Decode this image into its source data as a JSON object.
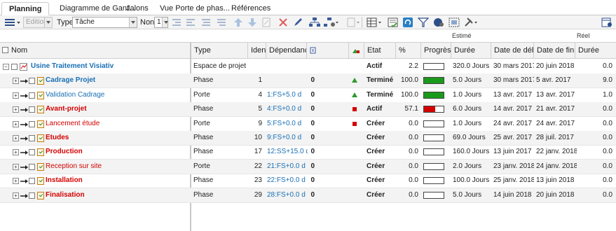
{
  "tabs": [
    {
      "label": "Planning",
      "active": true
    },
    {
      "label": "Diagramme de Gant..."
    },
    {
      "label": "Jalons"
    },
    {
      "label": "Vue Porte de phas..."
    },
    {
      "label": "Références"
    }
  ],
  "toolbar": {
    "edition_label": "Edition",
    "type_label": "Type",
    "type_value": "Tâche",
    "non_label": "Non",
    "level_value": "1"
  },
  "groups": {
    "estime": "Estimé",
    "reel": "Réel"
  },
  "columns": {
    "nom": "Nom",
    "type": "Type",
    "ident": "Identi",
    "dependance": "Dépendance",
    "etat": "Etat",
    "pct": "%",
    "progres": "Progrès",
    "duree": "Durée",
    "debut": "Date de début",
    "fin": "Date de fin",
    "duree_reel": "Durée"
  },
  "colors": {
    "red": "#d40000",
    "blue": "#1a6fb5",
    "green": "#1a9a1a",
    "accent": "#1a6fb5"
  },
  "rows": [
    {
      "nom": "Usine Traitement Visiativ",
      "type": "Espace de projet",
      "ident": "",
      "dep": "",
      "count": "",
      "etat": "Actif",
      "pct": "2.2",
      "progress": 0.0,
      "duree": "320.0 Jours",
      "debut": "30 mars 2017",
      "fin": "20 juin 2018",
      "reel": "0.0",
      "indicator": ""
    },
    {
      "nom": "Cadrage Projet",
      "type": "Phase",
      "ident": "1",
      "dep": "",
      "count": "0",
      "etat": "Terminé",
      "pct": "100.0",
      "progress": 1.0,
      "duree": "5.0 Jours",
      "debut": "30 mars 2017",
      "fin": "5 avr. 2017",
      "reel": "9.0",
      "indicator": "up"
    },
    {
      "nom": "Validation Cadrage",
      "type": "Porte",
      "ident": "4",
      "dep": "1:FS+5.0 d",
      "count": "0",
      "etat": "Terminé",
      "pct": "100.0",
      "progress": 1.0,
      "duree": "1.0 Jours",
      "debut": "13 avr. 2017",
      "fin": "13 avr. 2017",
      "reel": "1.0",
      "indicator": "up"
    },
    {
      "nom": "Avant-projet",
      "type": "Phase",
      "ident": "5",
      "dep": "4:FS+0.0 d",
      "count": "0",
      "etat": "Actif",
      "pct": "57.1",
      "progress": 0.571,
      "duree": "6.0 Jours",
      "debut": "14 avr. 2017",
      "fin": "21 avr. 2017",
      "reel": "0.0",
      "indicator": "red"
    },
    {
      "nom": "Lancement étude",
      "type": "Porte",
      "ident": "9",
      "dep": "5:FS+0.0 d",
      "count": "0",
      "etat": "Créer",
      "pct": "0.0",
      "progress": 0.0,
      "duree": "1.0 Jours",
      "debut": "24 avr. 2017",
      "fin": "24 avr. 2017",
      "reel": "0.0",
      "indicator": "red"
    },
    {
      "nom": "Etudes",
      "type": "Phase",
      "ident": "10",
      "dep": "9:FS+0.0 d",
      "count": "0",
      "etat": "Créer",
      "pct": "0.0",
      "progress": 0.0,
      "duree": "69.0 Jours",
      "debut": "25 avr. 2017",
      "fin": "28 juil. 2017",
      "reel": "0.0",
      "indicator": ""
    },
    {
      "nom": "Production",
      "type": "Phase",
      "ident": "17",
      "dep": "12:SS+15.0 d",
      "count": "0",
      "etat": "Créer",
      "pct": "0.0",
      "progress": 0.0,
      "duree": "160.0 Jours",
      "debut": "13 juin 2017",
      "fin": "22 janv. 2018",
      "reel": "0.0",
      "indicator": ""
    },
    {
      "nom": "Reception sur site",
      "type": "Porte",
      "ident": "22",
      "dep": "21:FS+0.0 d",
      "count": "0",
      "etat": "Créer",
      "pct": "0.0",
      "progress": 0.0,
      "duree": "2.0 Jours",
      "debut": "23 janv. 2018",
      "fin": "24 janv. 2018",
      "reel": "0.0",
      "indicator": ""
    },
    {
      "nom": "Installation",
      "type": "Phase",
      "ident": "23",
      "dep": "22:FS+0.0 d",
      "count": "0",
      "etat": "Créer",
      "pct": "0.0",
      "progress": 0.0,
      "duree": "100.0 Jours",
      "debut": "25 janv. 2018",
      "fin": "13 juin 2018",
      "reel": "0.0",
      "indicator": ""
    },
    {
      "nom": "Finalisation",
      "type": "Phase",
      "ident": "29",
      "dep": "28:FS+0.0 d",
      "count": "0",
      "etat": "Créer",
      "pct": "0.0",
      "progress": 0.0,
      "duree": "5.0 Jours",
      "debut": "14 juin 2018",
      "fin": "20 juin 2018",
      "reel": "0.0",
      "indicator": ""
    }
  ]
}
